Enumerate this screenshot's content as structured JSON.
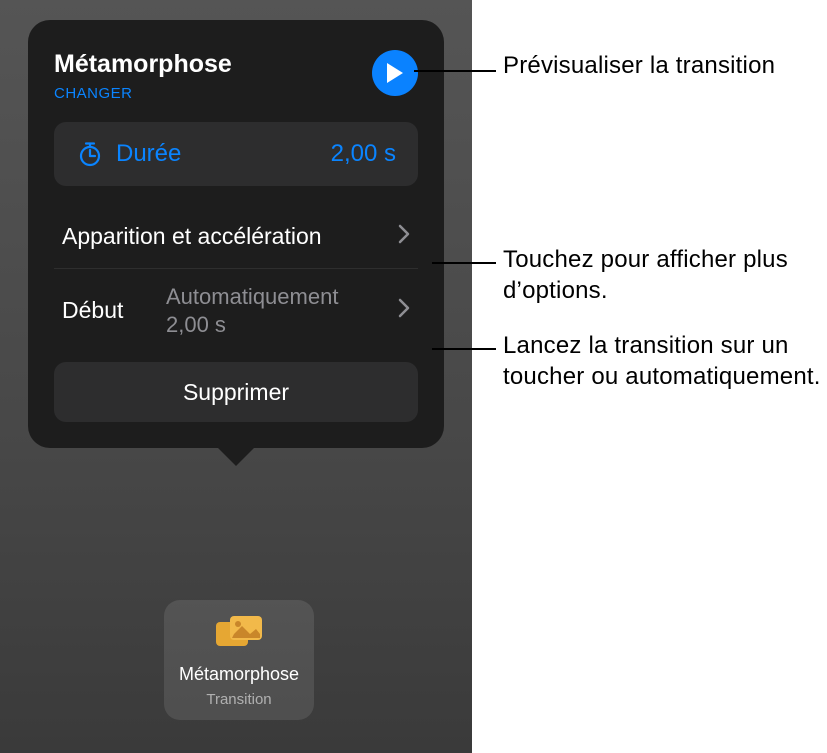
{
  "popover": {
    "title": "Métamorphose",
    "change_label": "CHANGER",
    "duration_label": "Durée",
    "duration_value": "2,00 s",
    "appearance_label": "Apparition et accélération",
    "start_label": "Début",
    "start_value_line1": "Automatiquement",
    "start_value_line2": "2,00 s",
    "delete_label": "Supprimer"
  },
  "chip": {
    "title": "Métamorphose",
    "subtitle": "Transition"
  },
  "callouts": {
    "preview": "Prévisualiser la transition",
    "more_options": "Touchez pour afficher plus d’options.",
    "start_help": "Lancez la transition sur un toucher ou automatiquement."
  }
}
